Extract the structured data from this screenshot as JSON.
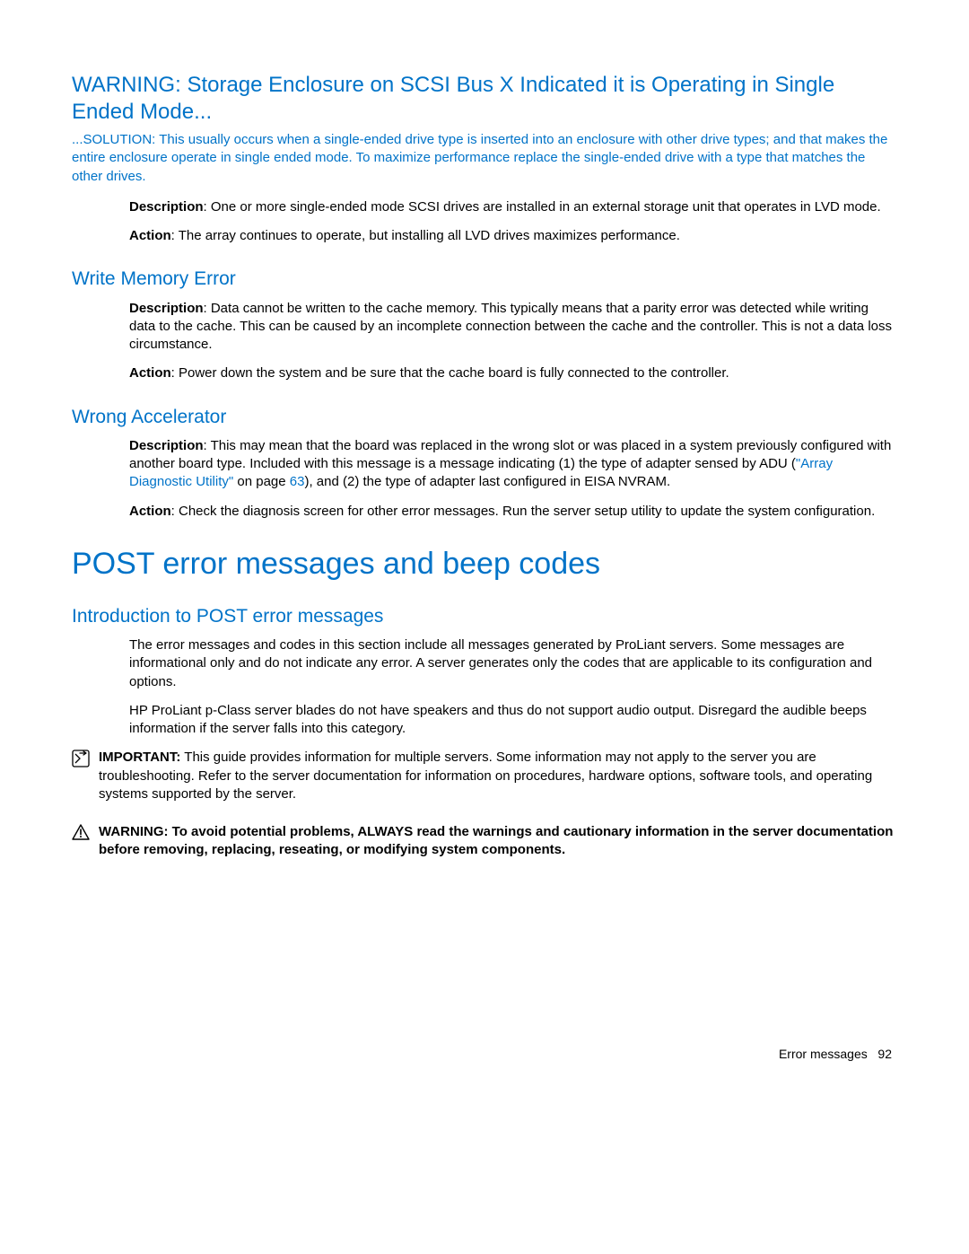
{
  "section1": {
    "title": "WARNING: Storage Enclosure on SCSI Bus X Indicated it is Operating in Single Ended Mode...",
    "solution": "...SOLUTION: This usually occurs when a single-ended drive type is inserted into an enclosure with other drive types; and that makes the entire enclosure operate in single ended mode. To maximize performance replace the single-ended drive with a type that matches the other drives.",
    "desc_label": "Description",
    "desc_text": ": One or more single-ended mode SCSI drives are installed in an external storage unit that operates in LVD mode.",
    "action_label": "Action",
    "action_text": ": The array continues to operate, but installing all LVD drives maximizes performance."
  },
  "section2": {
    "title": "Write Memory Error",
    "desc_label": "Description",
    "desc_text": ": Data cannot be written to the cache memory. This typically means that a parity error was detected while writing data to the cache. This can be caused by an incomplete connection between the cache and the controller. This is not a data loss circumstance.",
    "action_label": "Action",
    "action_text": ": Power down the system and be sure that the cache board is fully connected to the controller."
  },
  "section3": {
    "title": "Wrong Accelerator",
    "desc_label": "Description",
    "desc_text_a": ": This may mean that the board was replaced in the wrong slot or was placed in a system previously configured with another board type. Included with this message is a message indicating (1) the type of adapter sensed by ADU (",
    "link_text": "\"Array Diagnostic Utility\"",
    "desc_text_b": " on page ",
    "page_ref": "63",
    "desc_text_c": "), and (2) the type of adapter last configured in EISA NVRAM.",
    "action_label": "Action",
    "action_text": ": Check the diagnosis screen for other error messages. Run the server setup utility to update the system configuration."
  },
  "main_heading": "POST error messages and beep codes",
  "section4": {
    "title": "Introduction to POST error messages",
    "p1": "The error messages and codes in this section include all messages generated by ProLiant servers. Some messages are informational only and do not indicate any error. A server generates only the codes that are applicable to its configuration and options.",
    "p2": "HP ProLiant p-Class server blades do not have speakers and thus do not support audio output. Disregard the audible beeps information if the server falls into this category.",
    "important_label": "IMPORTANT:",
    "important_text": "  This guide provides information for multiple servers. Some information may not apply to the server you are troubleshooting. Refer to the server documentation for information on procedures, hardware options, software tools, and operating systems supported by the server.",
    "warning_label": "WARNING:  To avoid potential problems, ALWAYS read the warnings and cautionary information in the server documentation before removing, replacing, reseating, or modifying system components."
  },
  "footer": {
    "section": "Error messages",
    "page": "92"
  }
}
